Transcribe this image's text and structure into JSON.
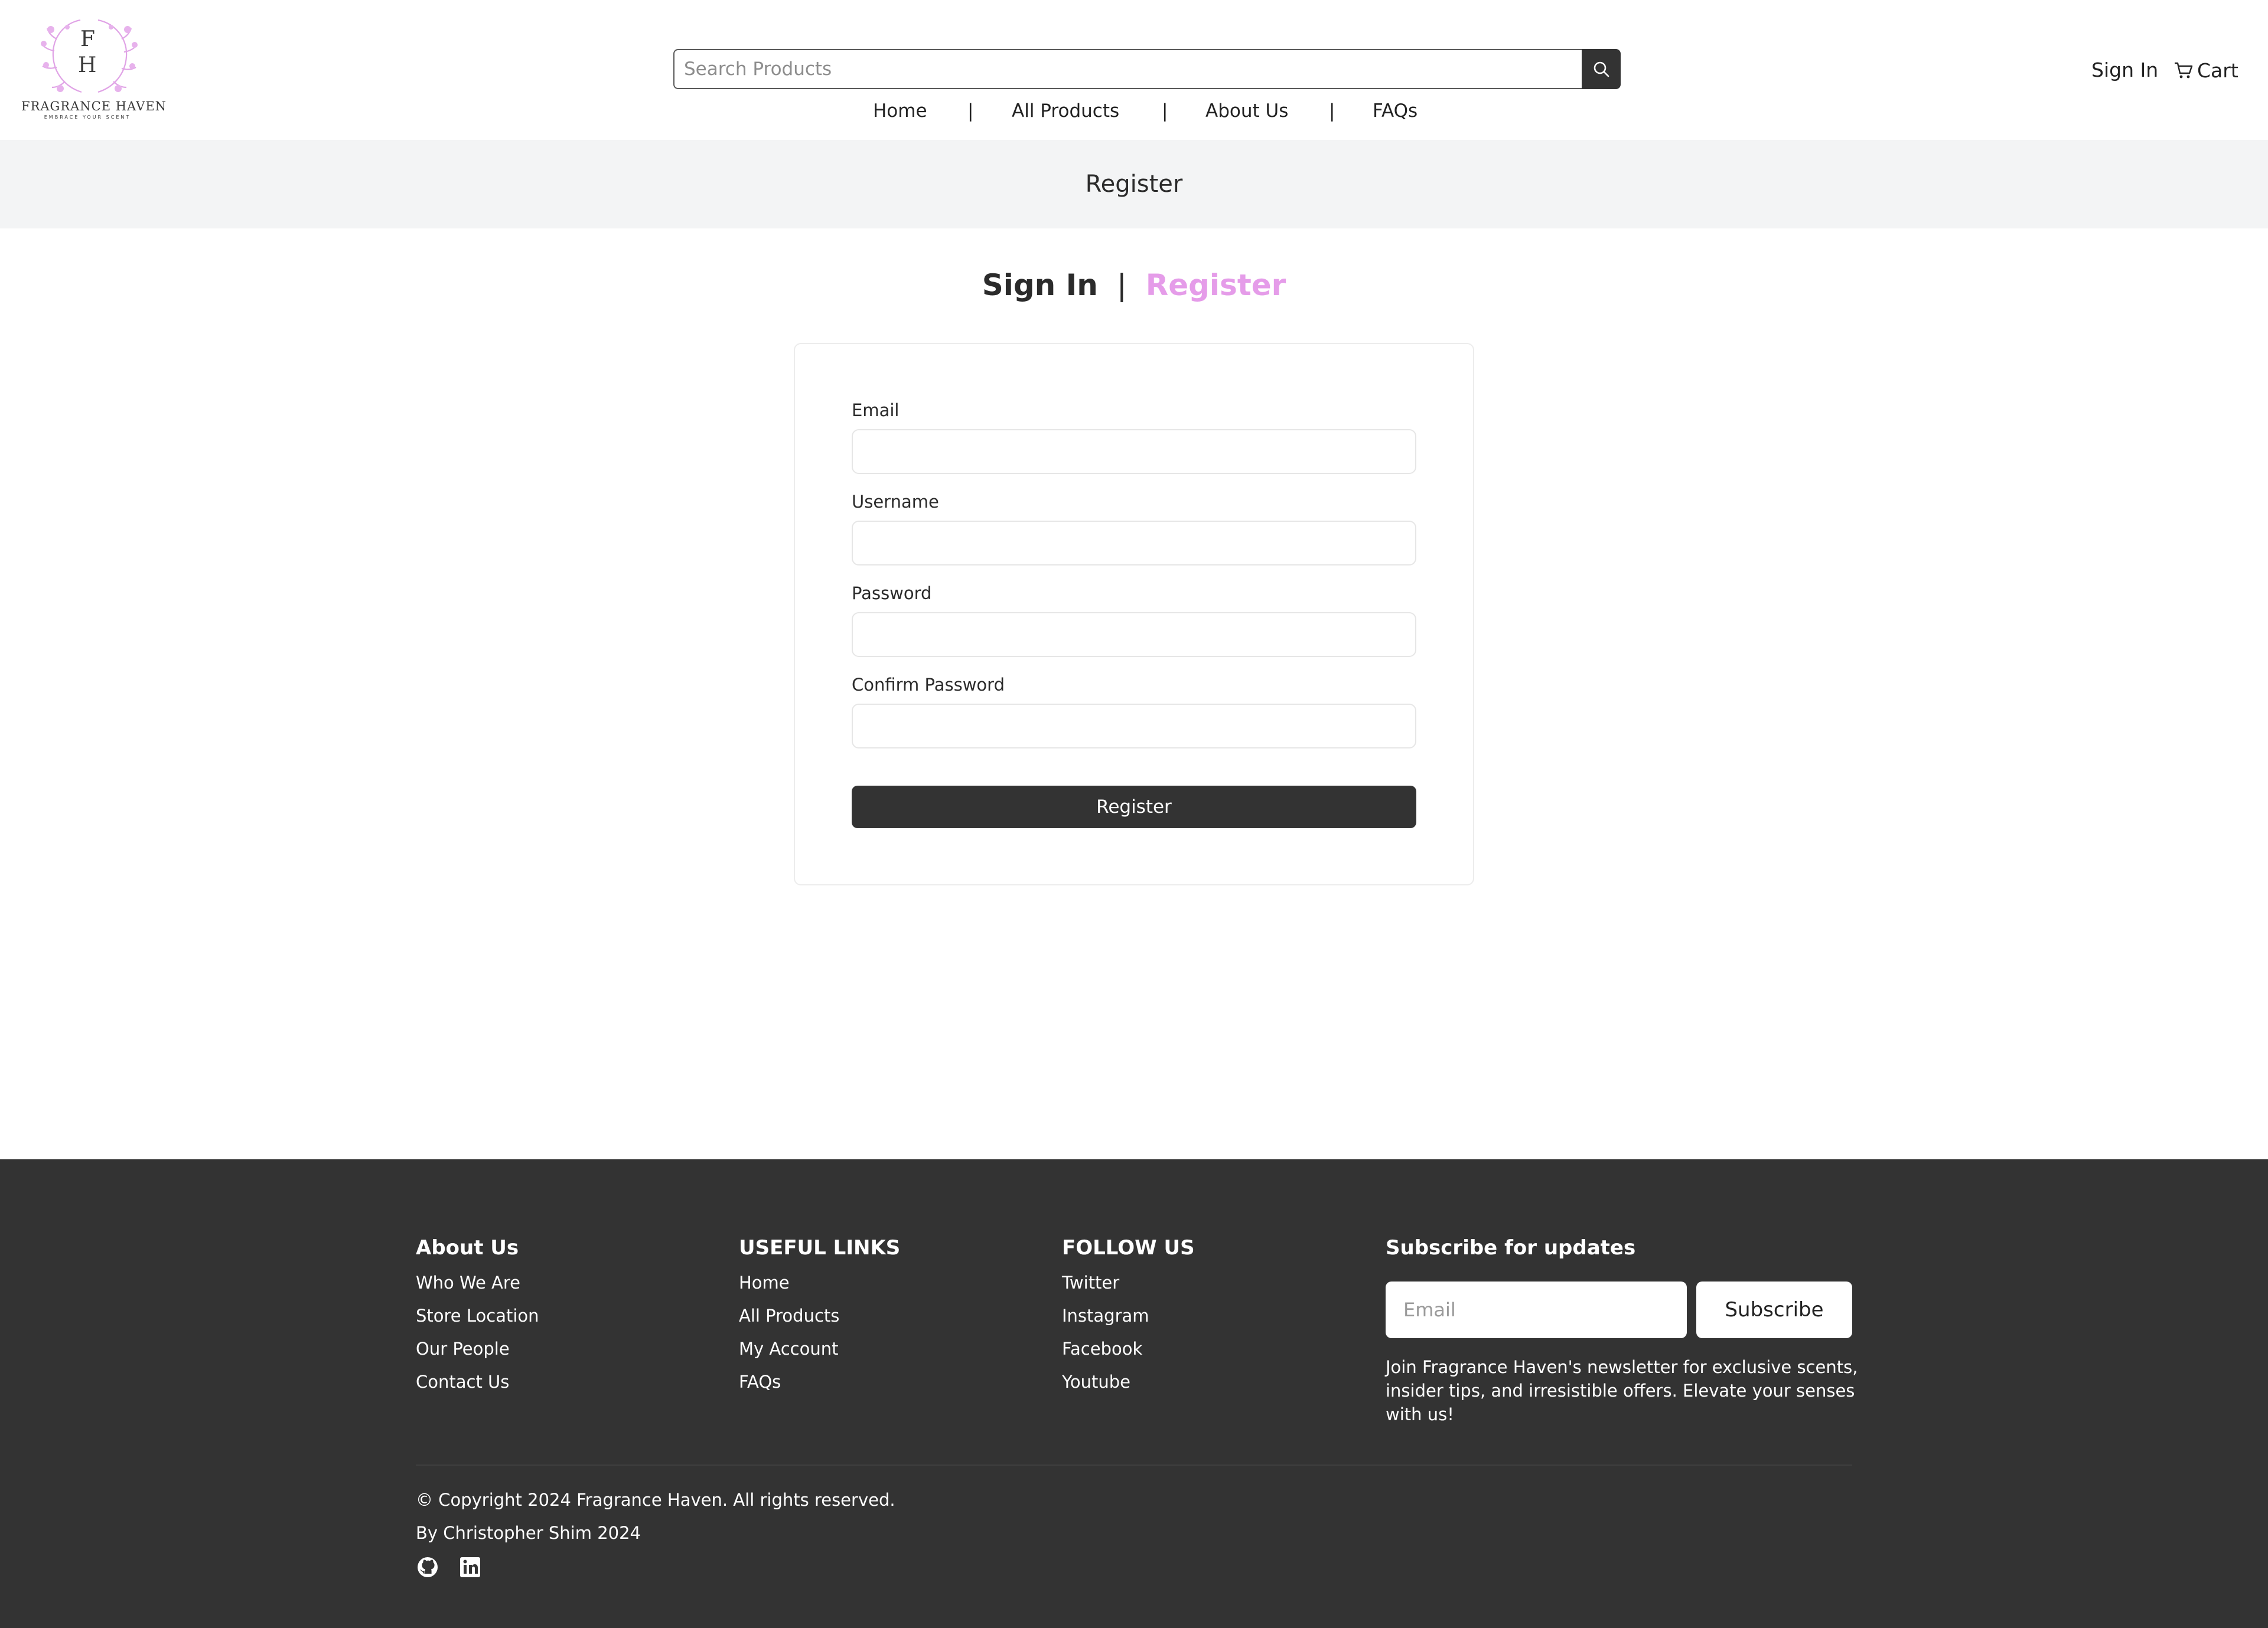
{
  "brand": {
    "monogram_top": "F",
    "monogram_bottom": "H",
    "name": "FRAGRANCE HAVEN",
    "tagline": "EMBRACE YOUR SCENT",
    "accent_color": "#e59ce9"
  },
  "header": {
    "search_placeholder": "Search Products",
    "search_icon": "search-icon",
    "nav": [
      "Home",
      "All Products",
      "About Us",
      "FAQs"
    ],
    "nav_separator": "|",
    "sign_in": "Sign In",
    "cart": "Cart",
    "cart_icon": "cart-icon"
  },
  "page": {
    "title": "Register"
  },
  "auth_switch": {
    "sign_in": "Sign In",
    "separator": "|",
    "register": "Register"
  },
  "form": {
    "email_label": "Email",
    "username_label": "Username",
    "password_label": "Password",
    "confirm_password_label": "Confirm Password",
    "submit": "Register"
  },
  "footer": {
    "about": {
      "heading": "About Us",
      "links": [
        "Who We Are",
        "Store Location",
        "Our People",
        "Contact Us"
      ]
    },
    "useful": {
      "heading": "USEFUL LINKS",
      "links": [
        "Home",
        "All Products",
        "My Account",
        "FAQs"
      ]
    },
    "follow": {
      "heading": "FOLLOW US",
      "links": [
        "Twitter",
        "Instagram",
        "Facebook",
        "Youtube"
      ]
    },
    "subscribe": {
      "heading": "Subscribe for updates",
      "email_placeholder": "Email",
      "button": "Subscribe",
      "description": "Join Fragrance Haven's newsletter for exclusive scents, insider tips, and irresistible offers. Elevate your senses with us!"
    },
    "copyright": "© Copyright 2024 Fragrance Haven. All rights reserved.",
    "byline": "By Christopher Shim 2024",
    "social_icons": [
      "github-icon",
      "linkedin-icon"
    ]
  }
}
